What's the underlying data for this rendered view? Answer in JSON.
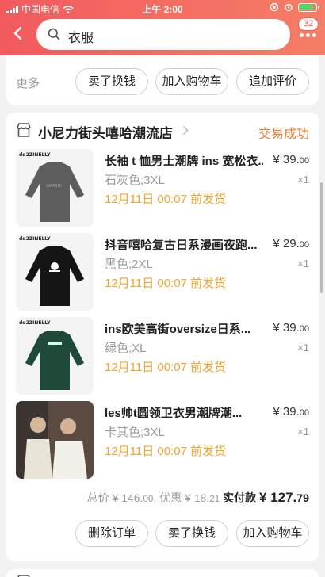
{
  "status_bar": {
    "carrier": "中国电信",
    "time": "上午 2:00"
  },
  "search": {
    "query": "衣服",
    "badge": "32"
  },
  "top_card": {
    "more_label": "更多",
    "buttons": [
      "卖了换钱",
      "加入购物车",
      "追加评价"
    ]
  },
  "order": {
    "shop_name": "小尼力街头嘻哈潮流店",
    "status": "交易成功",
    "items": [
      {
        "title": "长袖t恤男士潮牌ins宽松衣服",
        "title_display": "长袖 t 恤男士潮牌 ins 宽松衣...",
        "price_main": "¥ 39.",
        "price_dec": "00",
        "sku": "石灰色;3XL",
        "qty": "×1",
        "ship": "12月11日 00:07 前发货",
        "shirt_color": "#5d5d5d"
      },
      {
        "title_display": "抖音嘻哈复古日系漫画夜跑...",
        "price_main": "¥ 29.",
        "price_dec": "00",
        "sku": "黑色;2XL",
        "qty": "×1",
        "ship": "12月11日 00:07 前发货",
        "shirt_color": "#151515"
      },
      {
        "title_display": "ins欧美高街oversize日系...",
        "price_main": "¥ 39.",
        "price_dec": "00",
        "sku": "绿色;XL",
        "qty": "×1",
        "ship": "12月11日 00:07 前发货",
        "shirt_color": "#1f4a3a"
      },
      {
        "title_display": "les帅t圆领卫衣男潮牌潮...",
        "price_main": "¥ 39.",
        "price_dec": "00",
        "sku": "卡其色;3XL",
        "qty": "×1",
        "ship": "12月11日 00:07 前发货",
        "shirt_color": "#e9e4d8"
      }
    ],
    "total_label": "总价",
    "total_main": "¥ 146.",
    "total_dec": "00",
    "discount_label": "优惠",
    "discount_main": "¥ 18.",
    "discount_dec": "21",
    "paid_label": "实付款",
    "paid_main": "¥ 127.",
    "paid_dec": "79",
    "buttons": [
      "删除订单",
      "卖了换钱",
      "加入购物车"
    ]
  },
  "colors": {
    "accent": "#f25a5e",
    "status": "#f07a2e",
    "ship": "#f0a52e"
  }
}
